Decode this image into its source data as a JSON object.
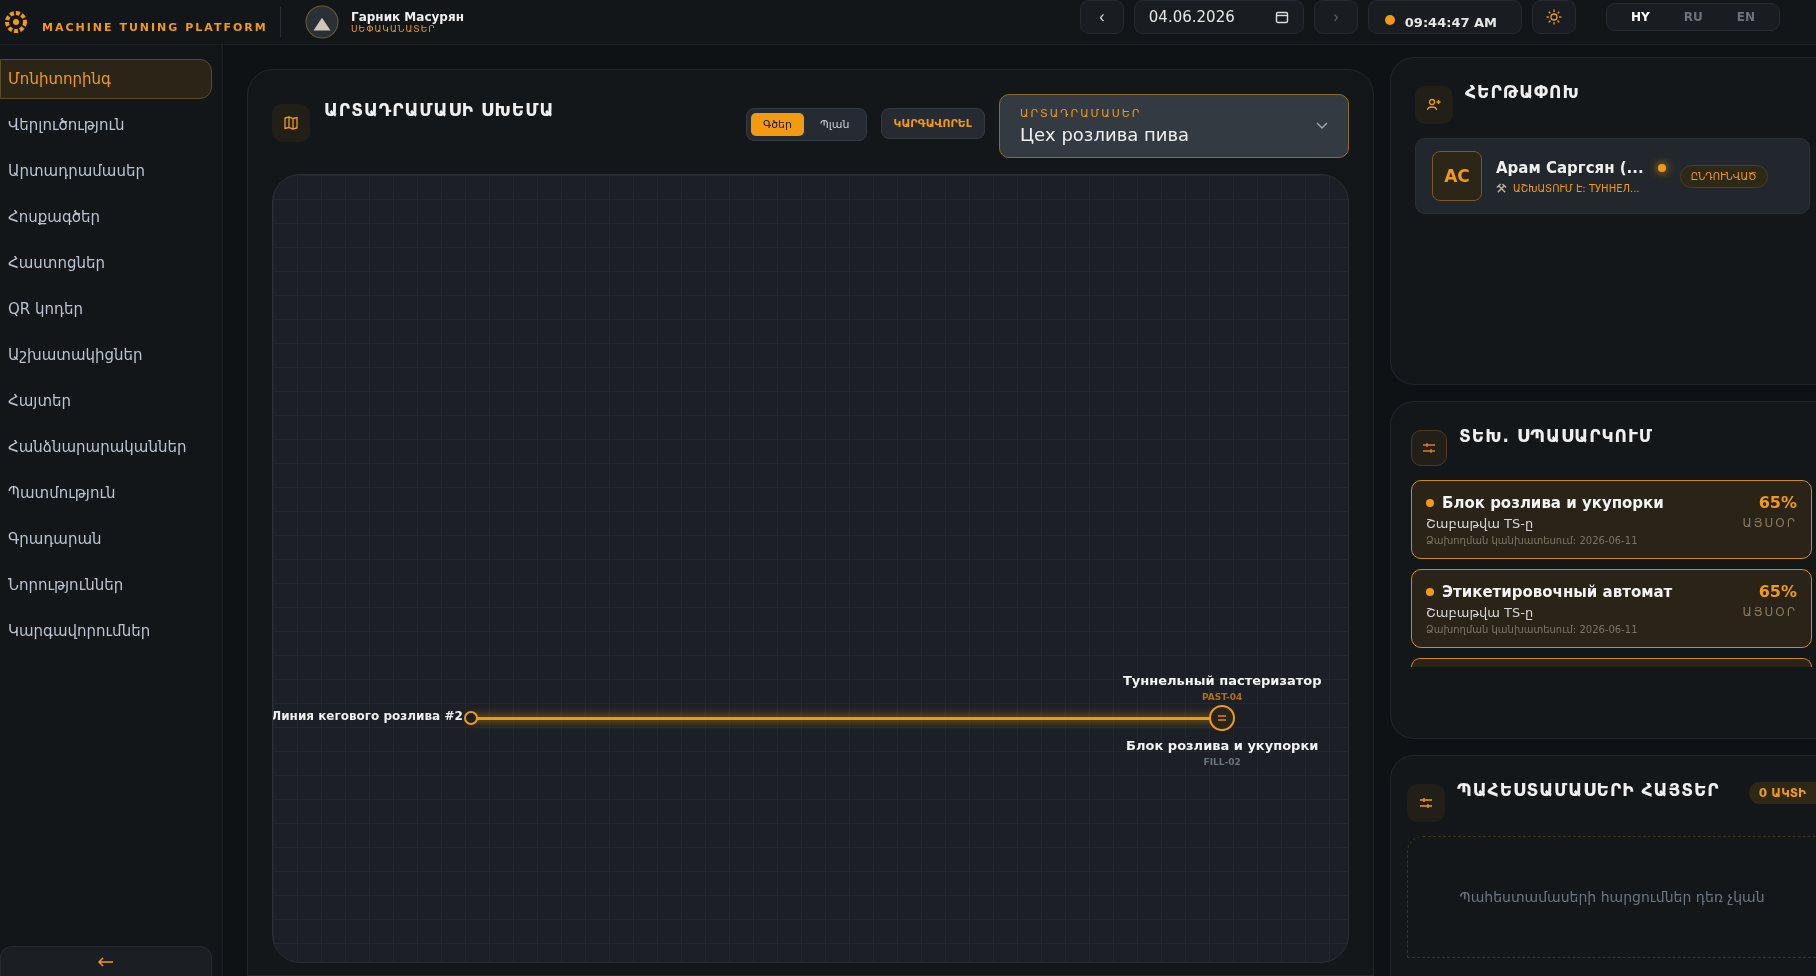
{
  "header": {
    "brand_subtitle": "MACHINE TUNING PLATFORM",
    "user": {
      "name": "Гарник Масурян",
      "role": "ՍԵՓԱԿԱՆԱՏԵՐ"
    },
    "prev_arrow": "‹",
    "next_arrow": "›",
    "date": "04.06.2026",
    "time": "09:44:47 AM",
    "languages": [
      {
        "label": "HY",
        "selected": true
      },
      {
        "label": "RU",
        "selected": false
      },
      {
        "label": "EN",
        "selected": false
      }
    ]
  },
  "sidebar": {
    "items": [
      {
        "label": "Մոնիտորինգ",
        "selected": true
      },
      {
        "label": "Վերլուծություն",
        "selected": false
      },
      {
        "label": "Արտադրամասեր",
        "selected": false
      },
      {
        "label": "Հոսքագծեր",
        "selected": false
      },
      {
        "label": "Հաստոցներ",
        "selected": false
      },
      {
        "label": "QR կոդեր",
        "selected": false
      },
      {
        "label": "Աշխատակիցներ",
        "selected": false
      },
      {
        "label": "Հայտեր",
        "selected": false
      },
      {
        "label": "Հանձնարարականներ",
        "selected": false
      },
      {
        "label": "Պատմություն",
        "selected": false
      },
      {
        "label": "Գրադարան",
        "selected": false
      },
      {
        "label": "Նորություններ",
        "selected": false
      },
      {
        "label": "Կարգավորումներ",
        "selected": false
      }
    ]
  },
  "schema": {
    "title": "ԱՐՏԱԴՐԱՄԱՍԻ ՍԽԵՄԱ",
    "view_tabs": [
      {
        "label": "Գծեր",
        "selected": true
      },
      {
        "label": "Պլան",
        "selected": false
      }
    ],
    "action": "ԿԱՐԳԱՎՈՐԵԼ",
    "workshop_select": {
      "label": "ԱՐՏԱԴՐԱՄԱՍԵՐ",
      "value": "Цех розлива пива"
    },
    "nodes": [
      {
        "kind": "line",
        "name": "Линия кегового розлива #2"
      },
      {
        "kind": "machine",
        "name": "Туннельный пастеризатор",
        "code": "PAST-04"
      },
      {
        "kind": "machine",
        "name": "Блок розлива и укупорки",
        "code": "FILL-02"
      }
    ]
  },
  "personnel": {
    "title": "ՀԵՐԹԱՓՈԽ",
    "workers": [
      {
        "initials": "АС",
        "name": "Арам Саргсян (...",
        "online": true,
        "task": "ԱՇԽԱՏՈՒՄ Է: ТУННЕЛ...",
        "status": "ԸՆԴՈՒՆՎԱԾ"
      }
    ]
  },
  "maintenance": {
    "title": "ՏԵԽ. ՍՊԱՍԱՐԿՈՒՄ",
    "items": [
      {
        "name": "Блок розлива и укупорки",
        "percent": "65%",
        "when": "ԱՅՍՕՐ",
        "type": "Շաբաթվա TS-ը",
        "forecast": "Ձախողման կանխատեսում: 2026-06-11"
      },
      {
        "name": "Этикетировочный автомат",
        "percent": "65%",
        "when": "ԱՅՍՕՐ",
        "type": "Շաբաթվա TS-ը",
        "forecast": "Ձախողման կանխատեսում: 2026-06-11"
      }
    ]
  },
  "requests": {
    "title": "ՊԱՀԵՍՏԱՄԱՍԵՐԻ ՀԱՅՏԵՐ",
    "badge": "0 ԱԿՏԻ",
    "empty": "Պահեստամասերի հարցումներ դեռ չկան"
  }
}
